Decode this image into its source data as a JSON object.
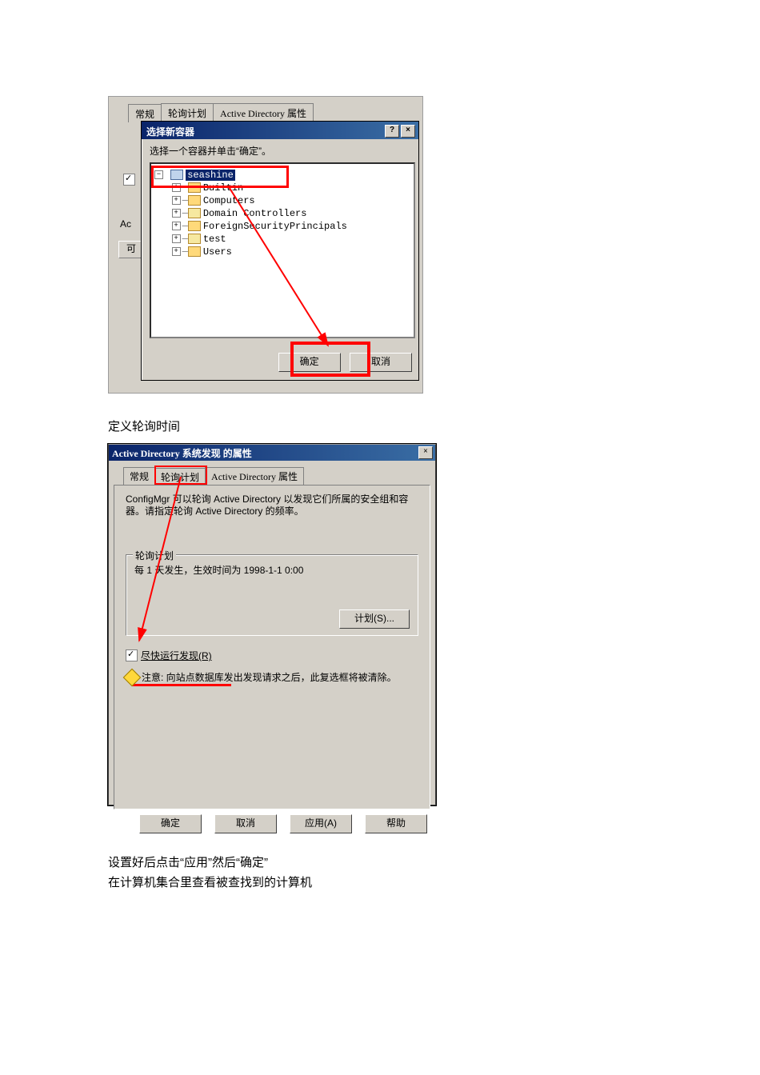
{
  "shot1": {
    "tabs": {
      "general": "常规",
      "polling": "轮询计划",
      "adprops": "Active Directory 属性"
    },
    "left_ac": "Ac",
    "left_mini": "可",
    "modal": {
      "title": "选择新容器",
      "help": "?",
      "close": "×",
      "instruction": "选择一个容器并单击“确定”。",
      "tree": {
        "root": "seashine",
        "n1": "Builtin",
        "n2": "Computers",
        "n3": "Domain Controllers",
        "n4": "ForeignSecurityPrincipals",
        "n5": "test",
        "n6": "Users"
      },
      "ok": "确定",
      "cancel": "取消"
    }
  },
  "caption1": "定义轮询时间",
  "shot2": {
    "title": "Active Directory 系统发现 的属性",
    "close": "×",
    "tabs": {
      "general": "常规",
      "polling": "轮询计划",
      "adprops": "Active Directory 属性"
    },
    "desc": "ConfigMgr 可以轮询 Active Directory 以发现它们所属的安全组和容器。请指定轮询 Active Directory 的频率。",
    "group_legend": "轮询计划",
    "schedule_text": "每 1 天发生，生效时间为 1998-1-1 0:00",
    "plan_button": "计划(S)...",
    "checkbox_label": "尽快运行发现(R)",
    "warning": "注意: 向站点数据库发出发现请求之后，此复选框将被清除。",
    "ok": "确定",
    "cancel": "取消",
    "apply": "应用(A)",
    "help": "帮助"
  },
  "caption2": "设置好后点击“应用”然后“确定”",
  "caption3": "在计算机集合里查看被查找到的计算机"
}
